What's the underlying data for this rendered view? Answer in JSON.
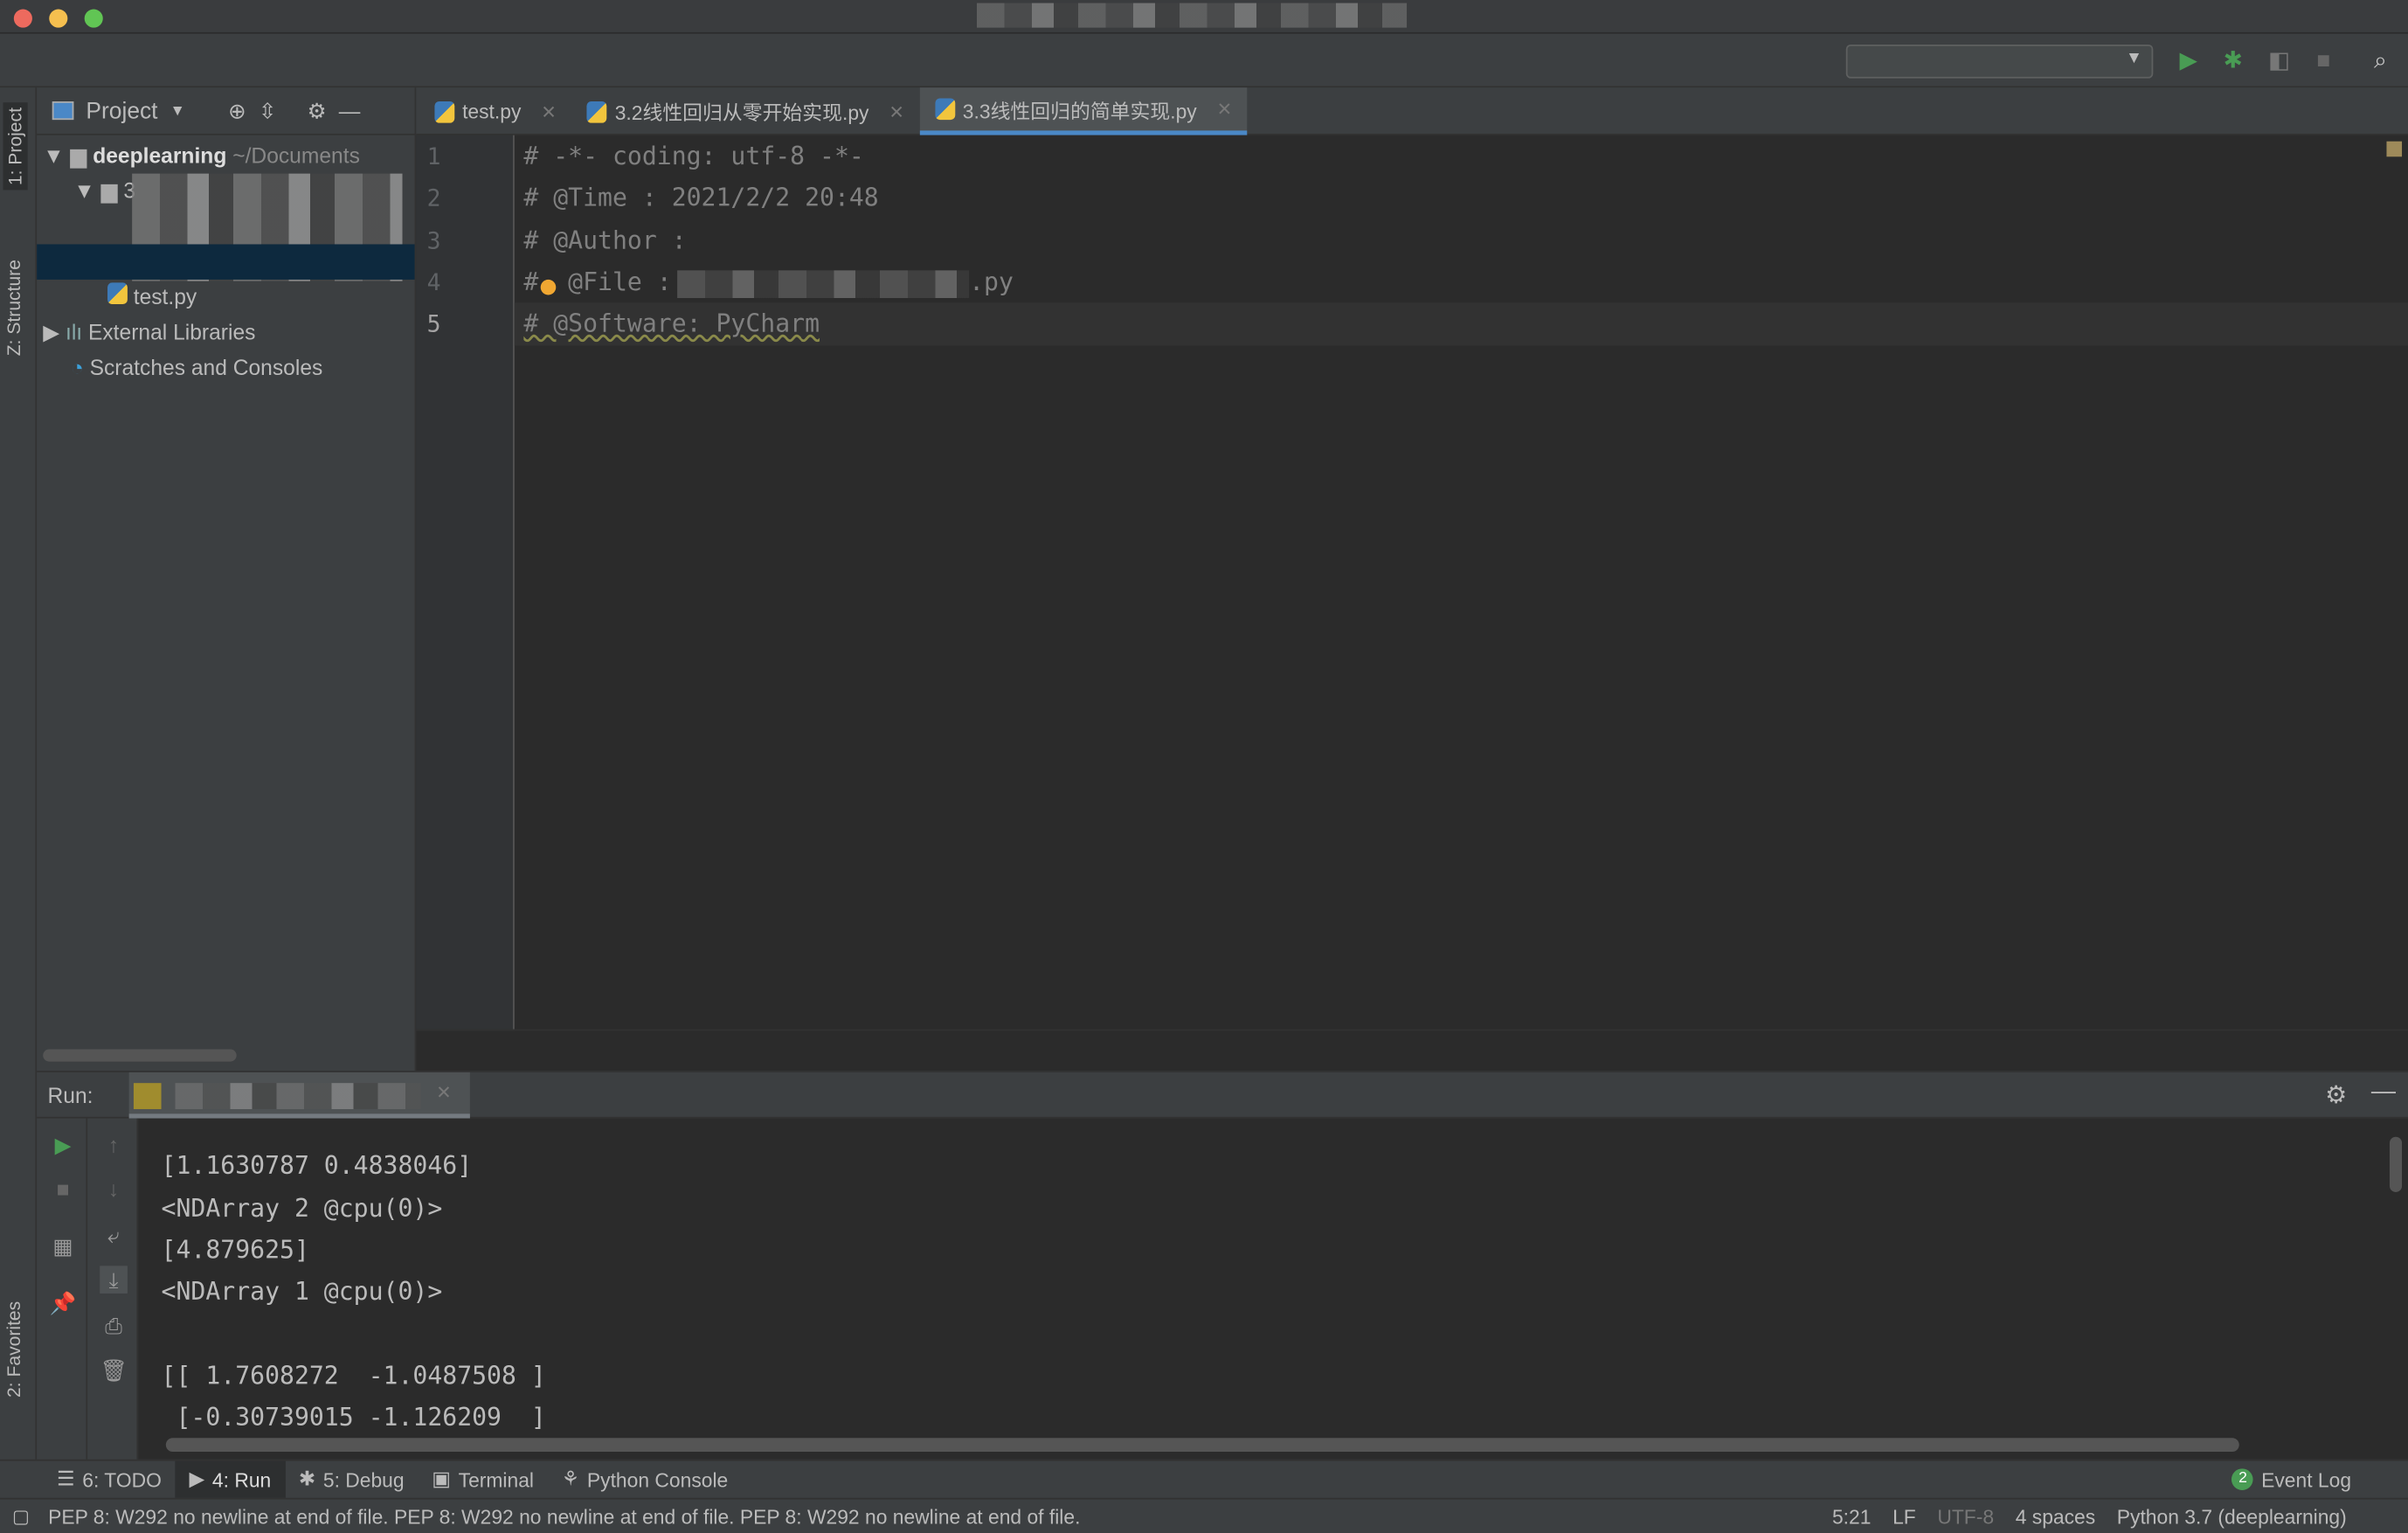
{
  "window": {
    "lights": [
      "#ed6a5e",
      "#f5bf4f",
      "#61c554"
    ]
  },
  "toolbar": {
    "icons": [
      "run-icon",
      "debug-icon",
      "coverage-icon",
      "stop-icon",
      "search-icon"
    ],
    "run_color": "#499c54"
  },
  "left_strip": {
    "project": "1: Project",
    "structure": "Z: Structure",
    "favorites": "2: Favorites"
  },
  "project": {
    "title": "Project",
    "tree": [
      {
        "label": "deeplearning",
        "hint": "~/Documents"
      },
      {
        "label": "3"
      },
      {
        "label": "test.py"
      },
      {
        "label": "External Libraries"
      },
      {
        "label": "Scratches and Consoles"
      }
    ]
  },
  "tabs": [
    {
      "label": "test.py"
    },
    {
      "label": "3.2线性回归从零开始实现.py"
    },
    {
      "label": "3.3线性回归的简单实现.py",
      "active": true
    }
  ],
  "editor": {
    "lines": [
      {
        "n": "1",
        "text": "# -*- coding: utf-8 -*-"
      },
      {
        "n": "2",
        "text": "# @Time : 2021/2/2 20:48"
      },
      {
        "n": "3",
        "text": "# @Author :"
      },
      {
        "n": "4",
        "text": "#  @File :",
        "suffix": ".py"
      },
      {
        "n": "5",
        "text": "# @Software: PyCharm"
      }
    ]
  },
  "run": {
    "label": "Run:",
    "output": [
      "[1.1630787 0.4838046]",
      "<NDArray 2 @cpu(0)>",
      "[4.879625]",
      "<NDArray 1 @cpu(0)>",
      "",
      "[[ 1.7608272  -1.0487508 ]",
      " [-0.30739015 -1.126209  ]"
    ]
  },
  "bottom_tabs": [
    {
      "label": "6: TODO"
    },
    {
      "label": "4: Run",
      "active": true
    },
    {
      "label": "5: Debug"
    },
    {
      "label": "Terminal"
    },
    {
      "label": "Python Console"
    }
  ],
  "event_log": {
    "count": "2",
    "label": "Event Log"
  },
  "status": {
    "message": "PEP 8: W292 no newline at end of file. PEP 8: W292 no newline at end of file. PEP 8: W292 no newline at end of file.",
    "position": "5:21",
    "line_sep": "LF",
    "encoding": "UTF-8",
    "indent": "4 spaces",
    "interpreter": "Python 3.7 (deeplearning)"
  }
}
